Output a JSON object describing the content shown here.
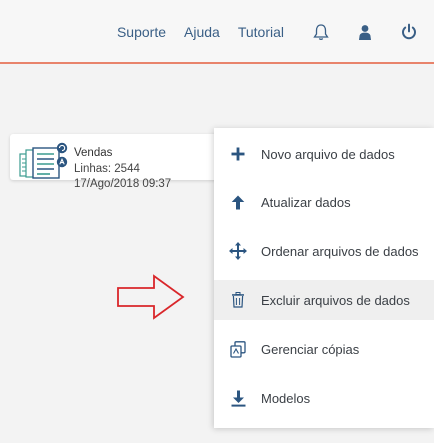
{
  "nav": {
    "links": [
      "Suporte",
      "Ajuda",
      "Tutorial"
    ],
    "icons": [
      "bell-icon",
      "user-icon",
      "power-icon"
    ]
  },
  "file_card": {
    "name": "Vendas",
    "lines": "Linhas: 2544",
    "date": "17/Ago/2018 09:37",
    "icon": "data-file-icon"
  },
  "context_menu": {
    "items": [
      {
        "label": "Novo arquivo de dados",
        "icon": "plus-icon"
      },
      {
        "label": "Atualizar dados",
        "icon": "arrow-up-icon"
      },
      {
        "label": "Ordenar arquivos de dados",
        "icon": "move-arrows-icon"
      },
      {
        "label": "Excluir arquivos de dados",
        "icon": "trash-icon",
        "highlighted": true
      },
      {
        "label": "Gerenciar cópias",
        "icon": "copies-icon"
      },
      {
        "label": "Modelos",
        "icon": "download-icon"
      }
    ]
  },
  "annotation": {
    "icon": "pointer-arrow-icon",
    "color": "#d9262a"
  },
  "colors": {
    "accent_line": "#e8836b",
    "link": "#3a5f86",
    "icon_blue": "#2b5580"
  }
}
